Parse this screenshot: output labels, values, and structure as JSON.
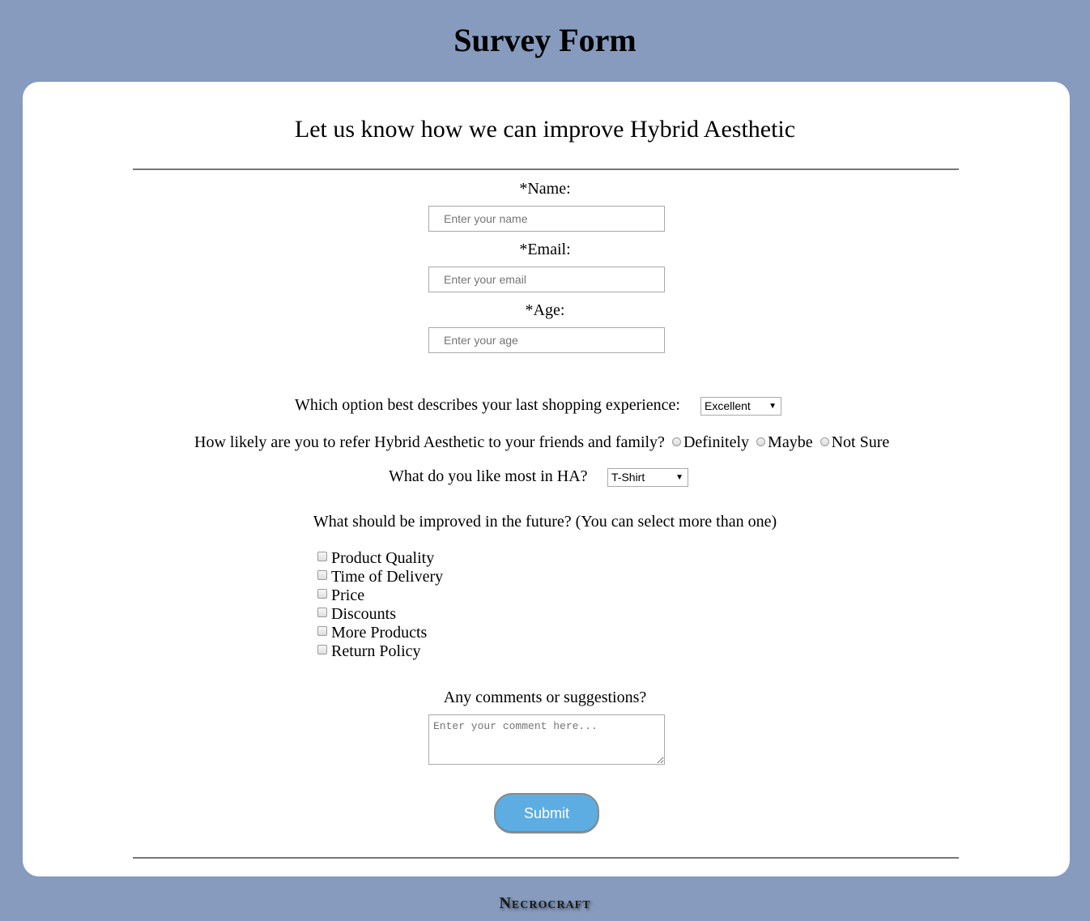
{
  "header": {
    "title": "Survey Form"
  },
  "form": {
    "subtitle": "Let us know how we can improve Hybrid Aesthetic",
    "name": {
      "label": "*Name:",
      "placeholder": "Enter your name"
    },
    "email": {
      "label": "*Email:",
      "placeholder": "Enter your email"
    },
    "age": {
      "label": "*Age:",
      "placeholder": "Enter your age"
    },
    "experience": {
      "question": "Which option best describes your last shopping experience:",
      "selected": "Excellent"
    },
    "refer": {
      "question": "How likely are you to refer Hybrid Aesthetic to your friends and family?",
      "options": [
        "Definitely",
        "Maybe",
        "Not Sure"
      ]
    },
    "like_most": {
      "question": "What do you like most in HA?",
      "selected": "T-Shirt"
    },
    "improve": {
      "question": "What should be improved in the future? (You can select more than one)",
      "options": [
        "Product Quality",
        "Time of Delivery",
        "Price",
        "Discounts",
        "More Products",
        "Return Policy"
      ]
    },
    "comments": {
      "label": "Any comments or suggestions?",
      "placeholder": "Enter your comment here..."
    },
    "submit_label": "Submit"
  },
  "footer": {
    "brand": "Necrocraft"
  },
  "colors": {
    "background": "#869bbd",
    "card": "#ffffff",
    "submit": "#5dade2"
  },
  "icons": {
    "select_arrow": "triangle-down-icon"
  }
}
